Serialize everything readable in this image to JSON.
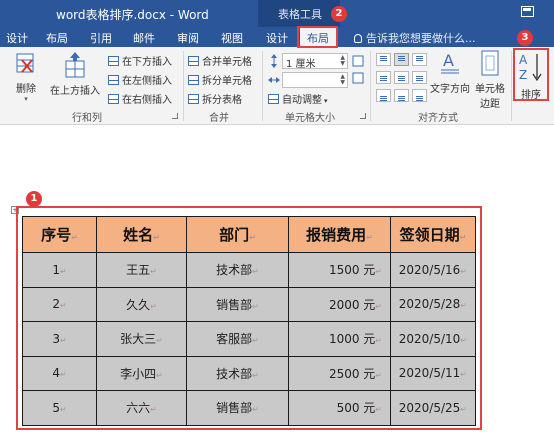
{
  "window": {
    "title": "word表格排序.docx - Word",
    "context_tab_group": "表格工具"
  },
  "tabs": [
    {
      "label": "设计"
    },
    {
      "label": "布局"
    },
    {
      "label": "引用"
    },
    {
      "label": "邮件"
    },
    {
      "label": "审阅"
    },
    {
      "label": "视图"
    },
    {
      "label": "设计"
    },
    {
      "label": "布局",
      "active": true
    }
  ],
  "tell_me": "告诉我您想要做什么...",
  "ribbon": {
    "rows_cols": {
      "delete": "删除",
      "insert_above": "在上方插入",
      "insert_below": "在下方插入",
      "insert_left": "在左侧插入",
      "insert_right": "在右侧插入",
      "label": "行和列"
    },
    "merge": {
      "merge_cells": "合并单元格",
      "split_cells": "拆分单元格",
      "split_table": "拆分表格",
      "label": "合并"
    },
    "cell_size": {
      "height_value": "1 厘米",
      "width_value": "",
      "autofit": "自动调整",
      "label": "单元格大小"
    },
    "alignment": {
      "text_direction": "文字方向",
      "cell_margins_1": "单元格",
      "cell_margins_2": "边距",
      "label": "对齐方式"
    },
    "data": {
      "sort": "排序"
    }
  },
  "callouts": [
    "1",
    "2",
    "3"
  ],
  "accent_color": "#2b579a",
  "highlight_color": "#e04343",
  "table": {
    "headers": [
      "序号",
      "姓名",
      "部门",
      "报销费用",
      "签领日期"
    ],
    "rows": [
      [
        "1",
        "王五",
        "技术部",
        "1500 元",
        "2020/5/16"
      ],
      [
        "2",
        "久久",
        "销售部",
        "2000 元",
        "2020/5/28"
      ],
      [
        "3",
        "张大三",
        "客服部",
        "1000 元",
        "2020/5/10"
      ],
      [
        "4",
        "李小四",
        "技术部",
        "2500 元",
        "2020/5/11"
      ],
      [
        "5",
        "六六",
        "销售部",
        "500 元",
        "2020/5/25"
      ]
    ],
    "paragraph_mark": "↵"
  }
}
